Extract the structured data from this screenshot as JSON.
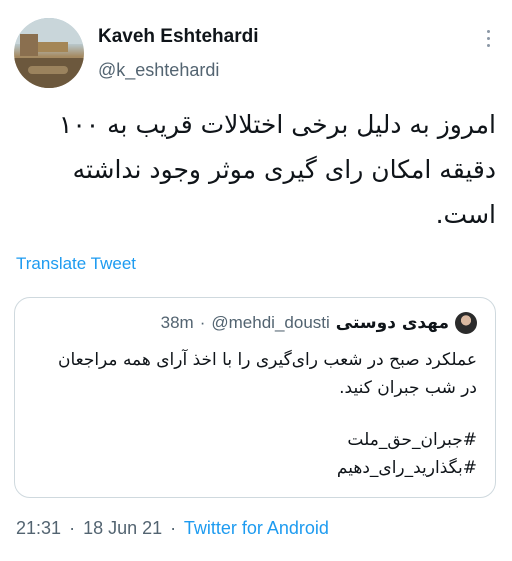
{
  "tweet": {
    "author_name": "Kaveh Eshtehardi",
    "author_handle": "@k_eshtehardi",
    "body_lines": [
      "امروز به دلیل برخی اختلالات قریب به ۱۰۰",
      "دقیقه امکان رای گیری موثر وجود نداشته",
      "است."
    ],
    "translate_label": "Translate Tweet",
    "time": "21:31",
    "separator": "·",
    "date": "18 Jun 21",
    "source": "Twitter for Android",
    "more_icon": "more-horizontal-icon"
  },
  "quoted": {
    "author_name": "مهدی دوستی",
    "author_handle": "@mehdi_dousti",
    "separator": "·",
    "time": "38m",
    "text_lines": [
      "عملکرد صبح در شعب رای‌گیری را با اخذ آرای همه مراجعان",
      "در شب جبران کنید."
    ],
    "hashtags": [
      "#جبران_حق_ملت",
      "#بگذارید_رای_دهیم"
    ]
  },
  "colors": {
    "link": "#1d9bf0",
    "muted": "#536471",
    "text": "#0f1419",
    "border": "#cfd9de"
  }
}
